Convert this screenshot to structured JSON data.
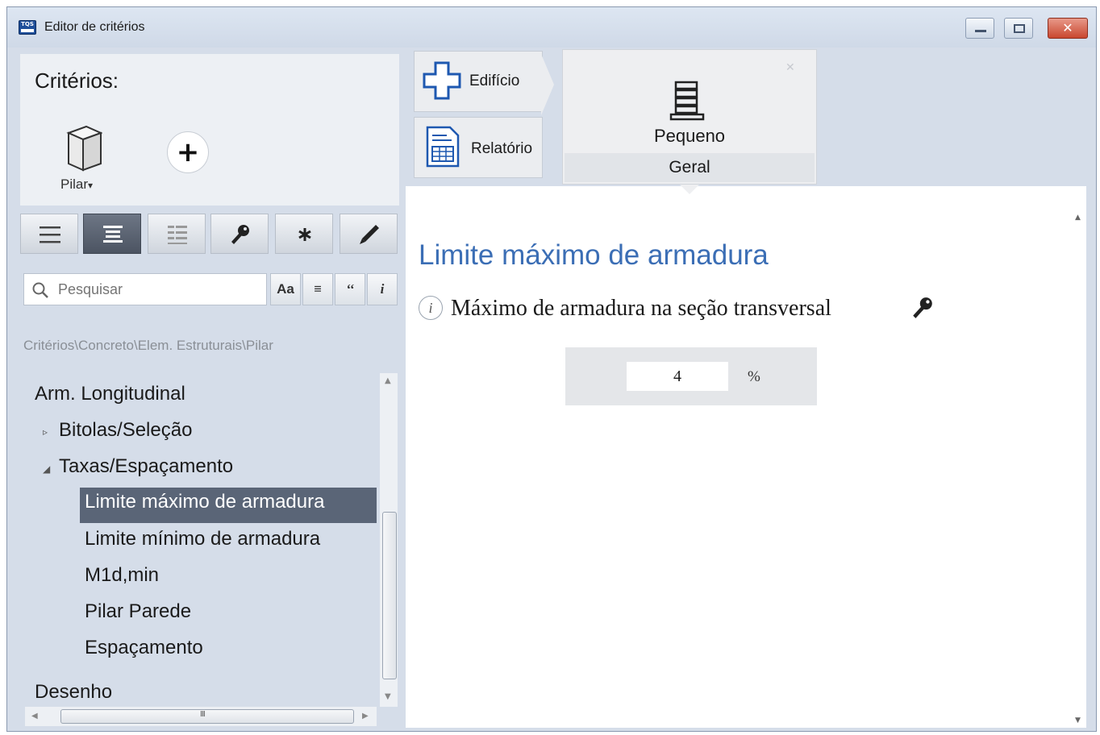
{
  "window": {
    "title": "Editor de critérios",
    "app_icon_text": "TQS"
  },
  "left": {
    "criteria_label": "Critérios:",
    "element_label": "Pilar",
    "element_dropdown_glyph": "▾",
    "add_glyph": "+",
    "toolbar": [
      "list-view-icon",
      "tree-view-icon",
      "details-view-icon",
      "key-icon",
      "asterisk-icon",
      "pencil-icon"
    ],
    "search_placeholder": "Pesquisar",
    "search_buttons": [
      "Aa",
      "≡",
      "‘‘",
      "i"
    ],
    "breadcrumb": "Critérios\\Concreto\\Elem. Estruturais\\Pilar",
    "tree": {
      "root": "Arm. Longitudinal",
      "child1": "Bitolas/Seleção",
      "child2": "Taxas/Espaçamento",
      "leaves": [
        "Limite máximo de armadura",
        "Limite mínimo de armadura",
        "M1d,min",
        "Pilar Parede",
        "Espaçamento"
      ],
      "root2": "Desenho",
      "collapsed_arrow": "▹",
      "expanded_arrow": "◢"
    },
    "hscroll_grip": "III"
  },
  "nav": {
    "edificio": "Edifício",
    "relatorio": "Relatório",
    "profile_name": "Pequeno",
    "profile_sub": "Geral"
  },
  "content": {
    "title": "Limite máximo de armadura",
    "info_glyph": "i",
    "param_label": "Máximo de armadura na seção transversal",
    "value": "4",
    "unit": "%"
  },
  "colors": {
    "title_blue": "#3b6eb5",
    "selection": "#5a6577",
    "close_red": "#c9472f"
  }
}
